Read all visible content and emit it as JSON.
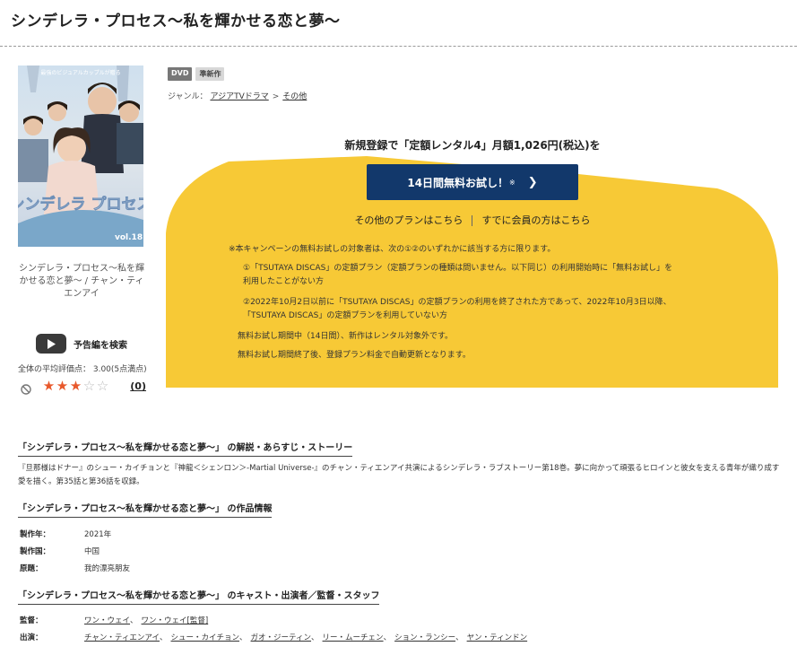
{
  "page": {
    "title": "シンデレラ・プロセス〜私を輝かせる恋と夢〜"
  },
  "product": {
    "cover_caption": "シンデレラ・プロセス〜私を輝かせる恋と夢〜 / チャン・ティエンアイ",
    "cover_art": {
      "logo_text": "シンデレラ プロセス",
      "volume": "vol.18",
      "tagline": "最強のビジュアルカップルが贈る"
    },
    "trailer_label": "予告編を検索",
    "avg_rating_text": "全体の平均評価点： 3.00(5点満点)",
    "rating_value": 3,
    "rating_max": 5,
    "review_count": "(0)",
    "badges": [
      "DVD",
      "準新作"
    ],
    "genre_label": "ジャンル：",
    "genre_path": [
      "アジアTVドラマ",
      "その他"
    ]
  },
  "promo": {
    "heading": "新規登録で「定額レンタル4」月額1,026円(税込)を",
    "button_label": "14日間無料お試し！",
    "button_mark": "※",
    "other_plans": "その他のプランはこちら",
    "members": "すでに会員の方はこちら",
    "note_intro": "※本キャンペーンの無料お試しの対象者は、次の①②のいずれかに該当する方に限ります。",
    "note_1_line1": "①「TSUTAYA DISCAS」の定額プラン（定額プランの種類は問いません。以下同じ）の利用開始時に「無料お試し」を",
    "note_1_line2": "利用したことがない方",
    "note_2_line1": "②2022年10月2日以前に「TSUTAYA DISCAS」の定額プランの利用を終了された方であって、2022年10月3日以降、",
    "note_2_line2": "「TSUTAYA DISCAS」の定額プランを利用していない方",
    "note_3": "無料お試し期間中（14日間）、新作はレンタル対象外です。",
    "note_4": "無料お試し期間終了後、登録プラン料金で自動更新となります。",
    "colors": {
      "yellow": "#f7c936",
      "navy": "#12386b"
    }
  },
  "synopsis_section": {
    "heading": "「シンデレラ・プロセス〜私を輝かせる恋と夢〜」 の解説・あらすじ・ストーリー",
    "text": "『旦那様はドナー』のシュー・カイチョンと『神龍＜シェンロン＞-Martial Universe-』のチャン・ティエンアイ共演によるシンデレラ・ラブストーリー第18巻。夢に向かって頑張るヒロインと彼女を支える青年が織り成す愛を描く。第35話と第36話を収録。"
  },
  "info_section": {
    "heading": "「シンデレラ・プロセス〜私を輝かせる恋と夢〜」 の作品情報",
    "rows": [
      {
        "label": "製作年：",
        "value": "2021年"
      },
      {
        "label": "製作国：",
        "value": "中国"
      },
      {
        "label": "原題：",
        "value": "我的漂亮朋友"
      }
    ]
  },
  "cast_section": {
    "heading": "「シンデレラ・プロセス〜私を輝かせる恋と夢〜」 のキャスト・出演者／監督・スタッフ",
    "director_label": "監督：",
    "directors": [
      "ワン・ウェイ",
      "ワン・ウェイ[監督]"
    ],
    "cast_label": "出演：",
    "cast": [
      "チャン・ティエンアイ",
      "シュー・カイチョン",
      "ガオ・ジーティン",
      "リー・ムーチェン",
      "ション・ランシー",
      "ヤン・ティンドン"
    ]
  }
}
